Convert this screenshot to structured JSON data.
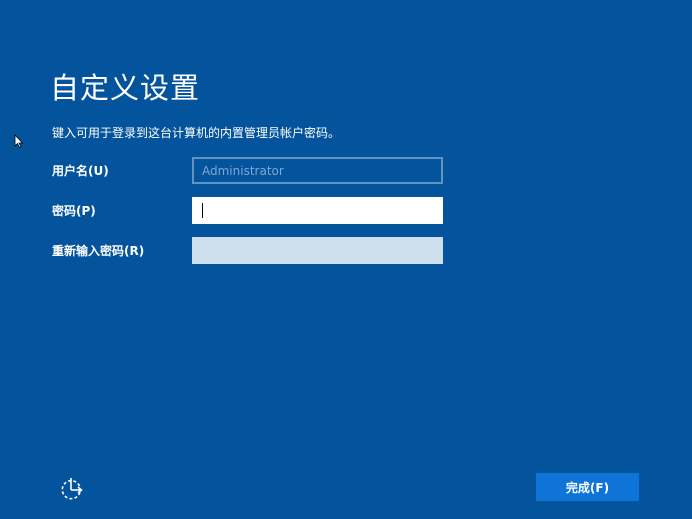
{
  "header": {
    "title": "自定义设置",
    "instruction": "键入可用于登录到这台计算机的内置管理员帐户密码。"
  },
  "form": {
    "username": {
      "label": "用户名(U)",
      "placeholder": "Administrator",
      "value": ""
    },
    "password": {
      "label": "密码(P)",
      "value": ""
    },
    "confirm_password": {
      "label": "重新输入密码(R)",
      "value": ""
    }
  },
  "footer": {
    "finish_label": "完成(F)",
    "accessibility_icon": "ease-of-access-icon"
  },
  "colors": {
    "background": "#04539d",
    "button": "#0f74d8",
    "disabled_field": "#cfdeed",
    "username_border": "#5f93c4"
  }
}
